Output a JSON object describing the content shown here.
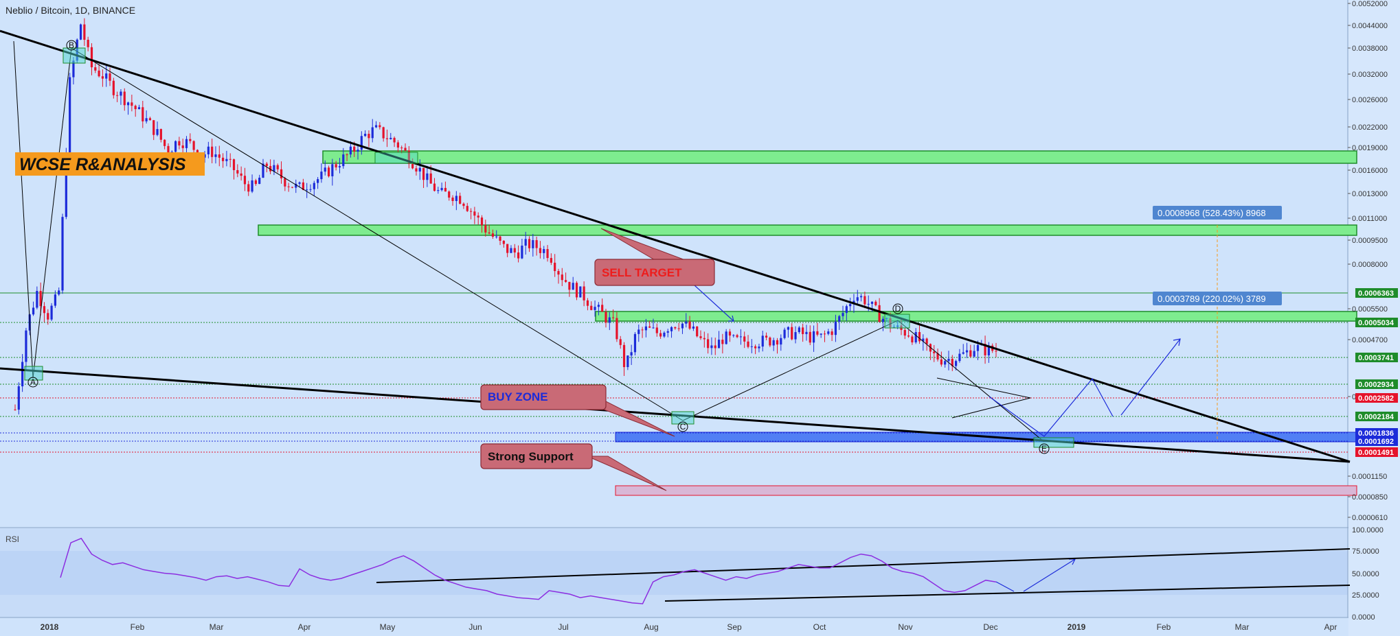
{
  "header": {
    "symbol_title": "Neblio / Bitcoin, 1D, BINANCE"
  },
  "overlays": {
    "brand_label": "WCSE R&ANALYSIS",
    "sell_target": "SELL TARGET",
    "buy_zone": "BUY ZONE",
    "strong_support": "Strong Support",
    "measure_1": "0.0008968 (528.43%) 8968",
    "measure_2": "0.0003789 (220.02%) 3789",
    "point_a": "A",
    "point_b": "B",
    "point_c": "C",
    "point_d": "D",
    "point_e": "E",
    "rsi_label": "RSI"
  },
  "colors": {
    "background": "#cfe3fb",
    "green_zone": "#7eec8f",
    "blue_zone": "#3b6df2",
    "pink_zone": "#d9b7d6",
    "candle_up": "#1c2bd9",
    "candle_down": "#e5132b",
    "rsi_line": "#8c2ee0",
    "callout_fill": "#c96a76",
    "orange_label": "#f59a1d"
  },
  "chart_data": {
    "type": "candlestick",
    "title": "Neblio / Bitcoin, 1D, BINANCE",
    "price_axis_ticks": [
      "0.0052000",
      "0.0044000",
      "0.0038000",
      "0.0032000",
      "0.0026000",
      "0.0022000",
      "0.0019000",
      "0.0016000",
      "0.0013000",
      "0.0011000",
      "0.0009500",
      "0.0008000",
      "0.0005500",
      "0.0004700",
      "0.0003300",
      "0.0001150",
      "0.0000850",
      "0.0000610"
    ],
    "price_tags": [
      {
        "label": "0.0006363",
        "color": "#1e8c2a"
      },
      {
        "label": "0.0005034",
        "color": "#1e8c2a"
      },
      {
        "label": "0.0003741",
        "color": "#1e8c2a"
      },
      {
        "label": "0.0002934",
        "color": "#1e8c2a"
      },
      {
        "label": "0.0002582",
        "color": "#e5132b"
      },
      {
        "label": "0.0002184",
        "color": "#1e8c2a"
      },
      {
        "label": "0.0001836",
        "color": "#1c2bd9"
      },
      {
        "label": "0.0001692",
        "color": "#1c2bd9"
      },
      {
        "label": "0.0001491",
        "color": "#e5132b"
      }
    ],
    "time_axis_labels": [
      "2018",
      "Feb",
      "Mar",
      "Apr",
      "May",
      "Jun",
      "Jul",
      "Aug",
      "Sep",
      "Oct",
      "Nov",
      "Dec",
      "2019",
      "Feb",
      "Mar",
      "Apr"
    ],
    "time_axis_bold": [
      "2018",
      "2019"
    ],
    "price_path": [
      [
        0,
        0.000155
      ],
      [
        1,
        0.00031
      ],
      [
        2,
        0.00043
      ],
      [
        3,
        0.00035
      ],
      [
        4,
        0.00042
      ],
      [
        5,
        0.0026
      ],
      [
        6,
        0.0044
      ],
      [
        7,
        0.003
      ],
      [
        8,
        0.0028
      ],
      [
        9,
        0.0025
      ],
      [
        10,
        0.0023
      ],
      [
        11,
        0.0021
      ],
      [
        12,
        0.0019
      ],
      [
        13,
        0.0017
      ],
      [
        14,
        0.00145
      ],
      [
        15,
        0.0016
      ],
      [
        16,
        0.00155
      ],
      [
        17,
        0.0014
      ],
      [
        18,
        0.00145
      ],
      [
        19,
        0.00135
      ],
      [
        20,
        0.00125
      ],
      [
        21,
        0.0011
      ],
      [
        22,
        0.00105
      ],
      [
        23,
        0.0013
      ],
      [
        24,
        0.0012
      ],
      [
        25,
        0.0011
      ],
      [
        26,
        0.00105
      ],
      [
        27,
        0.0011
      ],
      [
        28,
        0.00115
      ],
      [
        29,
        0.00125
      ],
      [
        30,
        0.00135
      ],
      [
        31,
        0.00145
      ],
      [
        32,
        0.00165
      ],
      [
        33,
        0.00175
      ],
      [
        34,
        0.00165
      ],
      [
        35,
        0.00155
      ],
      [
        36,
        0.0014
      ],
      [
        37,
        0.00125
      ],
      [
        38,
        0.0011
      ],
      [
        39,
        0.001
      ],
      [
        40,
        0.001
      ],
      [
        41,
        0.00096
      ],
      [
        42,
        0.00085
      ],
      [
        43,
        0.00075
      ],
      [
        44,
        0.00068
      ],
      [
        45,
        0.00062
      ],
      [
        46,
        0.0006
      ],
      [
        47,
        0.00065
      ],
      [
        48,
        0.00063
      ],
      [
        49,
        0.0006
      ],
      [
        50,
        0.0005
      ],
      [
        51,
        0.00045
      ],
      [
        52,
        0.00042
      ],
      [
        53,
        0.00038
      ],
      [
        54,
        0.00035
      ],
      [
        55,
        0.00032
      ],
      [
        56,
        0.00022
      ],
      [
        57,
        0.0003
      ],
      [
        58,
        0.00031
      ],
      [
        59,
        0.0003
      ],
      [
        60,
        0.00032
      ],
      [
        61,
        0.00033
      ],
      [
        62,
        0.00031
      ],
      [
        63,
        0.00028
      ],
      [
        64,
        0.00026
      ],
      [
        65,
        0.00029
      ],
      [
        66,
        0.00028
      ],
      [
        67,
        0.00028
      ],
      [
        68,
        0.00028
      ],
      [
        69,
        0.00028
      ],
      [
        70,
        0.00029
      ],
      [
        71,
        0.0003
      ],
      [
        72,
        0.0003
      ],
      [
        73,
        0.00029
      ],
      [
        74,
        0.00029
      ],
      [
        75,
        0.00031
      ],
      [
        76,
        0.00036
      ],
      [
        77,
        0.00042
      ],
      [
        78,
        0.0004
      ],
      [
        79,
        0.00036
      ],
      [
        80,
        0.00033
      ],
      [
        81,
        0.00031
      ],
      [
        82,
        0.0003
      ],
      [
        83,
        0.00028
      ],
      [
        84,
        0.00025
      ],
      [
        85,
        0.00024
      ],
      [
        86,
        0.00024
      ],
      [
        87,
        0.00025
      ],
      [
        88,
        0.000265
      ],
      [
        89,
        0.00026
      ],
      [
        90,
        0.0002582
      ]
    ],
    "levels": [
      "0.0006363",
      "0.0005034",
      "0.0003741",
      "0.0002934",
      "0.0002582",
      "0.0002184",
      "0.0001836",
      "0.0001692",
      "0.0001491"
    ],
    "rsi": {
      "name": "RSI",
      "axis_ticks": [
        "100.0000",
        "75.0000",
        "50.0000",
        "25.0000",
        "0.0000"
      ],
      "ylim": [
        0,
        100
      ],
      "values": [
        45,
        85,
        90,
        72,
        65,
        60,
        62,
        58,
        54,
        52,
        50,
        49,
        47,
        45,
        42,
        46,
        47,
        44,
        46,
        43,
        40,
        36,
        35,
        55,
        48,
        44,
        42,
        44,
        48,
        52,
        56,
        60,
        66,
        70,
        64,
        56,
        48,
        42,
        38,
        34,
        32,
        30,
        26,
        24,
        22,
        21,
        20,
        30,
        28,
        26,
        22,
        24,
        22,
        20,
        18,
        16,
        15,
        40,
        46,
        48,
        52,
        54,
        50,
        46,
        42,
        46,
        44,
        48,
        50,
        52,
        56,
        60,
        58,
        56,
        56,
        62,
        68,
        72,
        70,
        64,
        56,
        52,
        50,
        46,
        38,
        30,
        28,
        30,
        36,
        42,
        40
      ]
    },
    "grid": false,
    "legend": "none"
  }
}
